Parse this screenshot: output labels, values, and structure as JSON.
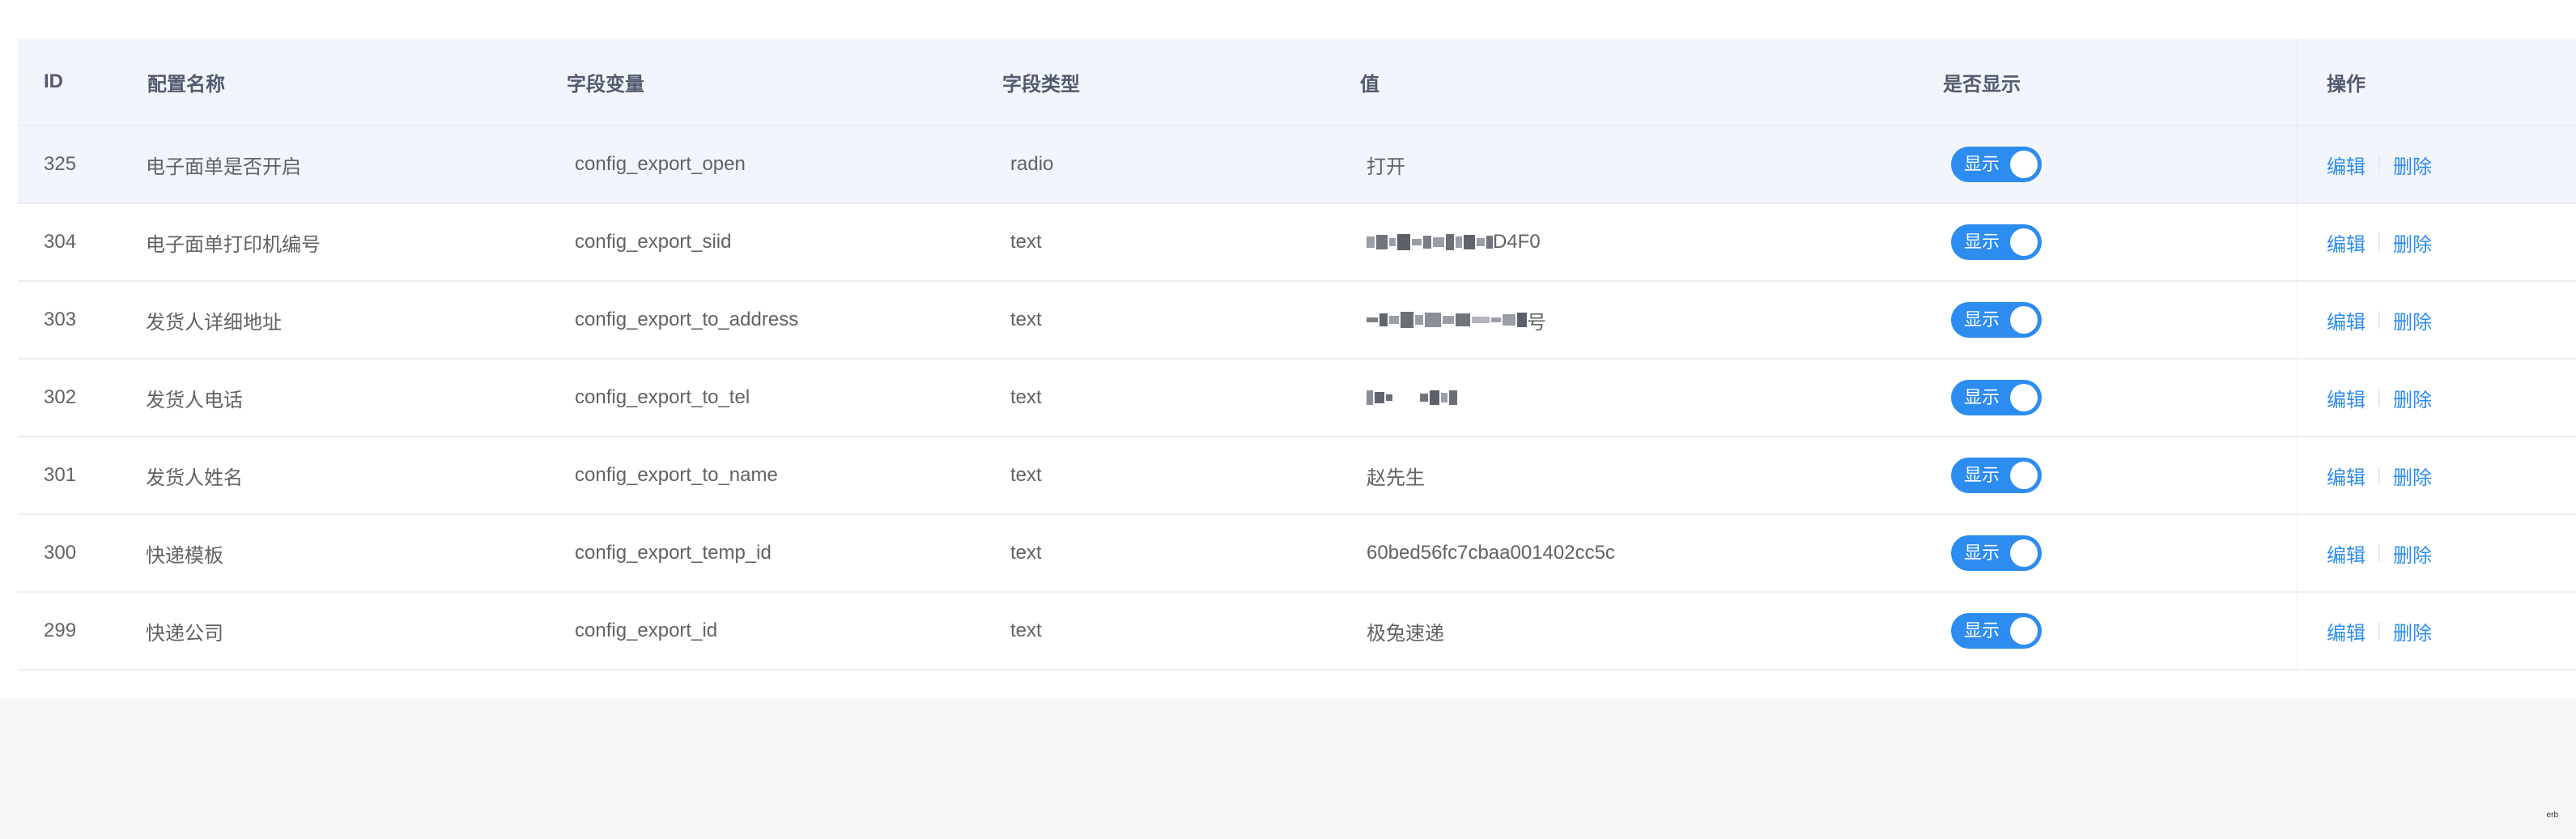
{
  "table": {
    "headers": {
      "id": "ID",
      "name": "配置名称",
      "var": "字段变量",
      "type": "字段类型",
      "value": "值",
      "show": "是否显示",
      "op": "操作"
    },
    "rows": [
      {
        "id": "325",
        "name": "电子面单是否开启",
        "var": "config_export_open",
        "type": "radio",
        "value": "打开",
        "value_prefix": "",
        "value_suffix": "",
        "show": "显示",
        "show_on": true,
        "edit": "编辑",
        "delete": "删除"
      },
      {
        "id": "304",
        "name": "电子面单打印机编号",
        "var": "config_export_siid",
        "type": "text",
        "value": "",
        "value_prefix": "",
        "value_suffix": "D4F0",
        "show": "显示",
        "show_on": true,
        "edit": "编辑",
        "delete": "删除"
      },
      {
        "id": "303",
        "name": "发货人详细地址",
        "var": "config_export_to_address",
        "type": "text",
        "value": "",
        "value_prefix": "",
        "value_suffix": "号",
        "show": "显示",
        "show_on": true,
        "edit": "编辑",
        "delete": "删除"
      },
      {
        "id": "302",
        "name": "发货人电话",
        "var": "config_export_to_tel",
        "type": "text",
        "value": "",
        "value_prefix": "",
        "value_suffix": "",
        "show": "显示",
        "show_on": true,
        "edit": "编辑",
        "delete": "删除"
      },
      {
        "id": "301",
        "name": "发货人姓名",
        "var": "config_export_to_name",
        "type": "text",
        "value": "赵先生",
        "value_prefix": "",
        "value_suffix": "",
        "show": "显示",
        "show_on": true,
        "edit": "编辑",
        "delete": "删除"
      },
      {
        "id": "300",
        "name": "快递模板",
        "var": "config_export_temp_id",
        "type": "text",
        "value": "60bed56fc7cbaa001402cc5c",
        "value_prefix": "",
        "value_suffix": "",
        "show": "显示",
        "show_on": true,
        "edit": "编辑",
        "delete": "删除"
      },
      {
        "id": "299",
        "name": "快递公司",
        "var": "config_export_id",
        "type": "text",
        "value": "极兔速递",
        "value_prefix": "",
        "value_suffix": "",
        "show": "显示",
        "show_on": true,
        "edit": "编辑",
        "delete": "删除"
      }
    ]
  },
  "colors": {
    "accent": "#2d8cf0",
    "header_bg": "#f2f6fc",
    "page_bg": "#f5f6f8"
  },
  "corner_mark": "erb"
}
